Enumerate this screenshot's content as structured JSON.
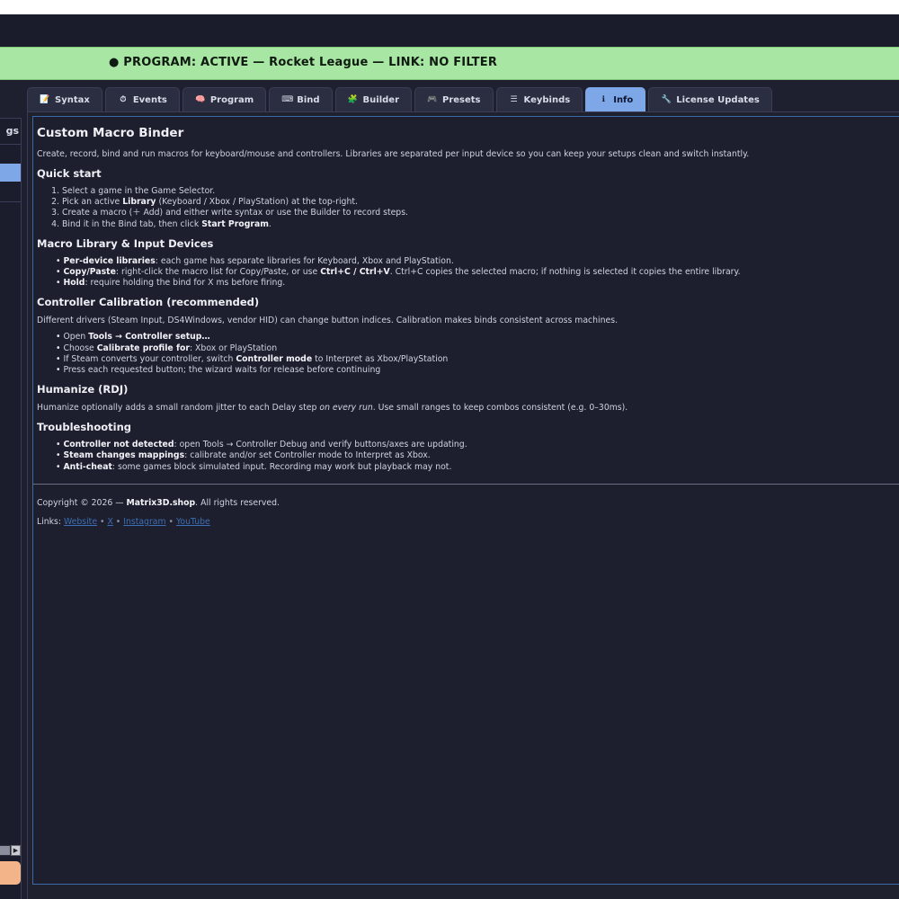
{
  "status": {
    "text": "● PROGRAM: ACTIVE — Rocket League — LINK: NO FILTER",
    "color": "#a8e6a3"
  },
  "left_panel": {
    "header_fragment": "gs"
  },
  "tabs": [
    {
      "icon": "📝",
      "icon_name": "note-icon",
      "label": "Syntax",
      "active": false
    },
    {
      "icon": "⏱",
      "icon_name": "timer-icon",
      "label": "Events",
      "active": false
    },
    {
      "icon": "🧠",
      "icon_name": "brain-icon",
      "label": "Program",
      "active": false
    },
    {
      "icon": "⌨",
      "icon_name": "keyboard-icon",
      "label": "Bind",
      "active": false
    },
    {
      "icon": "🧩",
      "icon_name": "puzzle-icon",
      "label": "Builder",
      "active": false
    },
    {
      "icon": "🎮",
      "icon_name": "gamepad-icon",
      "label": "Presets",
      "active": false
    },
    {
      "icon": "☰",
      "icon_name": "list-icon",
      "label": "Keybinds",
      "active": false
    },
    {
      "icon": "ℹ",
      "icon_name": "info-icon",
      "label": "Info",
      "active": true
    },
    {
      "icon": "🔧",
      "icon_name": "wrench-icon",
      "label": "License  Updates",
      "active": false
    }
  ],
  "info": {
    "title": "Custom Macro Binder",
    "intro": "Create, record, bind and run macros for keyboard/mouse and controllers. Libraries are separated per input device so you can keep your setups clean and switch instantly.",
    "quick_start": {
      "heading": "Quick start",
      "step1": "Select a game in the Game Selector.",
      "step2_a": "Pick an active ",
      "step2_b": "Library",
      "step2_c": " (Keyboard / Xbox / PlayStation) at the top-right.",
      "step3": "Create a macro (＋ Add) and either write syntax or use the Builder to record steps.",
      "step4_a": "Bind it in the Bind tab, then click ",
      "step4_b": "Start Program",
      "step4_c": "."
    },
    "library": {
      "heading": "Macro Library & Input Devices",
      "b1_bold": "Per-device libraries",
      "b1_text": ": each game has separate libraries for Keyboard, Xbox and PlayStation.",
      "b2_bold": "Copy/Paste",
      "b2_text_a": ": right-click the macro list for Copy/Paste, or use ",
      "b2_bold2": "Ctrl+C / Ctrl+V",
      "b2_text_b": ". Ctrl+C copies the selected macro; if nothing is selected it copies the entire library.",
      "b3_bold": "Hold",
      "b3_text": ": require holding the bind for X ms before firing."
    },
    "calibration": {
      "heading": "Controller Calibration (recommended)",
      "desc": "Different drivers (Steam Input, DS4Windows, vendor HID) can change button indices. Calibration makes binds consistent across machines.",
      "b1_a": "Open ",
      "b1_bold": "Tools → Controller setup…",
      "b2_a": "Choose ",
      "b2_bold": "Calibrate profile for",
      "b2_c": ": Xbox or PlayStation",
      "b3_a": "If Steam converts your controller, switch ",
      "b3_bold": "Controller mode",
      "b3_c": " to Interpret as Xbox/PlayStation",
      "b4": "Press each requested button; the wizard waits for release before continuing"
    },
    "humanize": {
      "heading": "Humanize (RDJ)",
      "desc_a": "Humanize optionally adds a small random jitter to each Delay step ",
      "desc_i": "on every run",
      "desc_c": ". Use small ranges to keep combos consistent (e.g. 0–30ms)."
    },
    "troubleshooting": {
      "heading": "Troubleshooting",
      "b1_bold": "Controller not detected",
      "b1_text": ": open Tools → Controller Debug and verify buttons/axes are updating.",
      "b2_bold": "Steam changes mappings",
      "b2_text": ": calibrate and/or set Controller mode to Interpret as Xbox.",
      "b3_bold": "Anti-cheat",
      "b3_text": ": some games block simulated input. Recording may work but playback may not."
    },
    "footer": {
      "copyright_a": "Copyright © 2026 — ",
      "copyright_b": "Matrix3D.shop",
      "copyright_c": ". All rights reserved.",
      "links_label": "Links: ",
      "links": [
        "Website",
        "X",
        "Instagram",
        "YouTube"
      ],
      "sep": " • "
    }
  }
}
